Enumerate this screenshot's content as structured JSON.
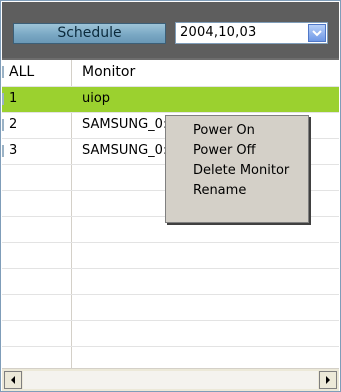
{
  "header": {
    "schedule_label": "Schedule",
    "date_value": "2004,10,03"
  },
  "table": {
    "columns": [
      "ALL",
      "Monitor"
    ],
    "rows": [
      {
        "all": "1",
        "monitor": "uiop",
        "selected": true
      },
      {
        "all": "2",
        "monitor": "SAMSUNG_0:",
        "selected": false
      },
      {
        "all": "3",
        "monitor": "SAMSUNG_0:",
        "selected": false
      }
    ]
  },
  "context_menu": {
    "items": [
      "Power On",
      "Power Off",
      "Delete Monitor",
      "Rename"
    ]
  },
  "colors": {
    "selection": "#9bd12f",
    "header_bg": "#5e5e5e",
    "button": "#7aa8c4"
  }
}
